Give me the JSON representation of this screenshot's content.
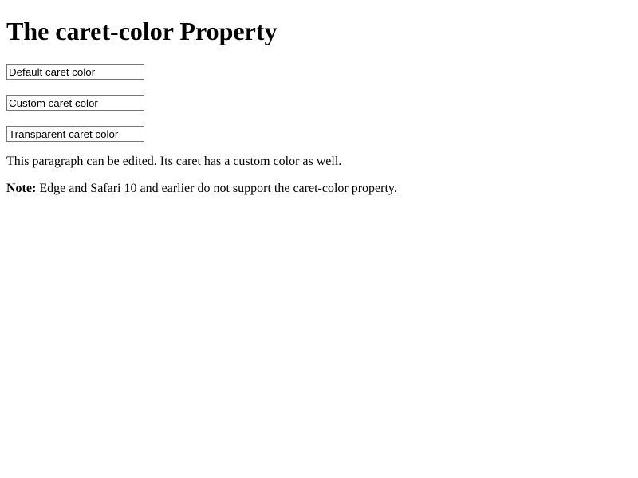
{
  "page": {
    "title": "The caret-color Property"
  },
  "inputs": [
    {
      "value": "Default caret color",
      "caret": "auto"
    },
    {
      "value": "Custom caret color",
      "caret": "#ff0000"
    },
    {
      "value": "Transparent caret color",
      "caret": "transparent"
    }
  ],
  "editable_paragraph": {
    "text": "This paragraph can be edited. Its caret has a custom color as well.",
    "caret": "#0000ff"
  },
  "note": {
    "label": "Note:",
    "text": " Edge and Safari 10 and earlier do not support the caret-color property."
  }
}
